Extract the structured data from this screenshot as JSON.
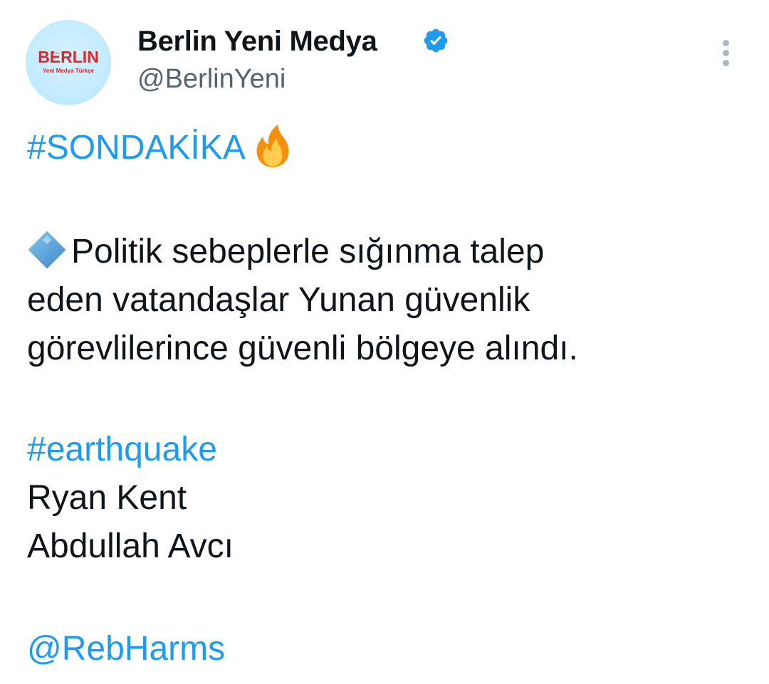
{
  "author": {
    "display_name": "Berlin Yeni Medya",
    "handle": "@BerlinYeni",
    "avatar_text": "BERLIN",
    "avatar_subtext": "Yeni Medya Türkçe",
    "verified": true
  },
  "tweet": {
    "hashtag_breaking": "#SONDAKİKA",
    "line1": "Politik sebeplerle sığınma talep",
    "line2": "eden vatandaşlar Yunan güvenlik",
    "line3": "görevlilerince güvenli bölgeye alındı.",
    "hashtag_earthquake": "#earthquake",
    "name1": "Ryan Kent",
    "name2": "Abdullah Avcı",
    "mention": "@RebHarms"
  },
  "icons": {
    "verified": "verified-badge-icon",
    "fire": "fire-icon",
    "diamond": "blue-diamond-icon",
    "more": "more-options-icon"
  },
  "colors": {
    "link": "#1d9bf0",
    "text": "#0f1419",
    "secondary": "#536471",
    "verified": "#1d9bf0",
    "avatar_bg": "#c4ebff",
    "logo_red": "#e0262b"
  }
}
